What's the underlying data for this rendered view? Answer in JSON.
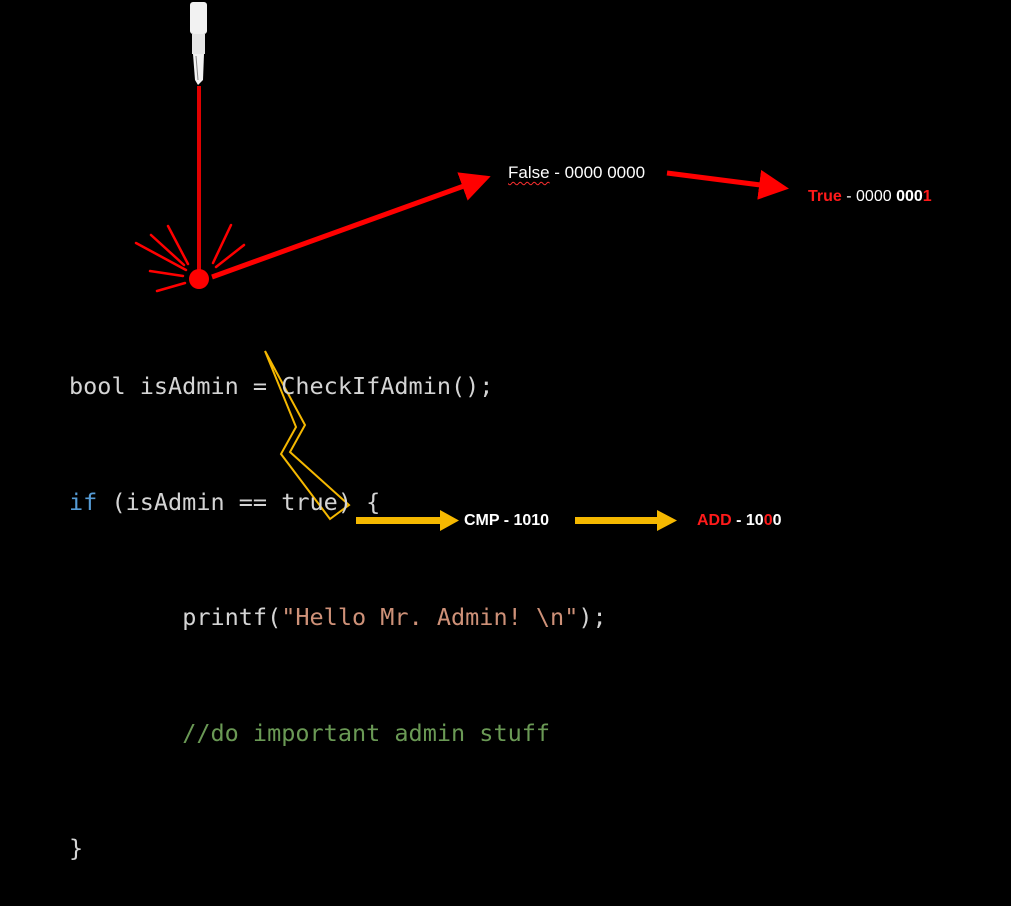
{
  "code": {
    "line1": "bool isAdmin = CheckIfAdmin();",
    "line2_keyword": "if",
    "line2_rest": " (isAdmin == true) {",
    "line3_indent": "        ",
    "line3_func": "printf(",
    "line3_string": "\"Hello Mr. Admin! \\n\"",
    "line3_end": ");",
    "line4_indent": "        ",
    "line4_comment": "//do important admin stuff",
    "line5": "}"
  },
  "labels": {
    "false_word": "False",
    "false_bits": " - 0000 0000",
    "true_word": "True",
    "true_sep": " - 0000 ",
    "true_bits_bold": "000",
    "true_bit_flip": "1",
    "cmp_text": "CMP - 1010",
    "add_word": "ADD",
    "add_sep": " - ",
    "add_bits_1": "10",
    "add_bit_flip": "0",
    "add_bits_2": "0"
  },
  "colors": {
    "background": "#000000",
    "laser": "#ff0000",
    "lightning": "#f5b800",
    "code_text": "#d4d4d4",
    "keyword": "#569cd6",
    "string": "#ce9178",
    "comment": "#6a9955",
    "highlight_red": "#ff1a1a"
  },
  "icons": {
    "laser_emitter": "laser-pointer-icon",
    "impact": "spark-burst-icon",
    "lightning": "lightning-bolt-icon"
  }
}
